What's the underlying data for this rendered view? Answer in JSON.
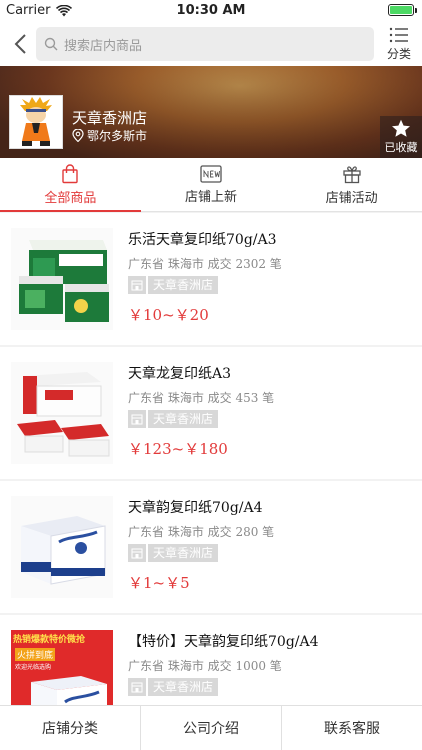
{
  "status": {
    "carrier": "Carrier",
    "time": "10:30 AM"
  },
  "nav": {
    "search_placeholder": "搜索店内商品",
    "category_label": "分类"
  },
  "shop": {
    "name": "天章香洲店",
    "location": "鄂尔多斯市",
    "favorite_label": "已收藏"
  },
  "tabs": [
    {
      "label": "全部商品",
      "active": true
    },
    {
      "label": "店铺上新",
      "active": false
    },
    {
      "label": "店铺活动",
      "active": false
    }
  ],
  "products": [
    {
      "title": "乐活天章复印纸70g/A3",
      "meta": "广东省 珠海市 成交 2302 笔",
      "shop": "天章香洲店",
      "price": "￥10~￥20"
    },
    {
      "title": "天章龙复印纸A3",
      "meta": "广东省 珠海市 成交 453 笔",
      "shop": "天章香洲店",
      "price": "￥123~￥180"
    },
    {
      "title": "天章韵复印纸70g/A4",
      "meta": "广东省 珠海市 成交 280 笔",
      "shop": "天章香洲店",
      "price": "￥1~￥5"
    },
    {
      "title": "【特价】天章韵复印纸70g/A4",
      "meta": "广东省 珠海市 成交 1000 笔",
      "shop": "天章香洲店",
      "price": "",
      "badge_top": "热销爆款特价微抢",
      "badge_sub": "火拼到底",
      "badge_small": "欢迎光临选购"
    }
  ],
  "bottom_bar": [
    "店铺分类",
    "公司介绍",
    "联系客服"
  ],
  "colors": {
    "accent": "#e23a3a",
    "battery": "#4cd964"
  }
}
